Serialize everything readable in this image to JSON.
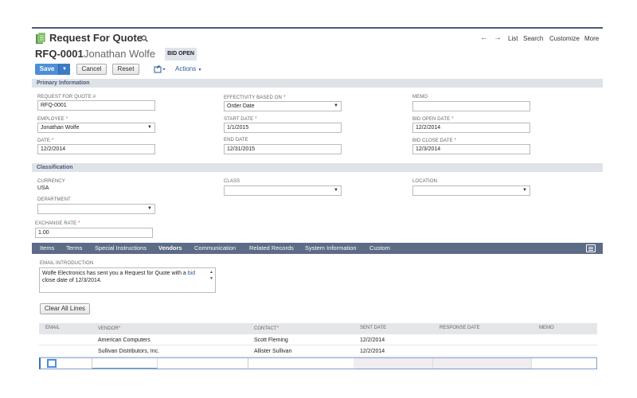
{
  "header": {
    "page_title": "Request For Quote",
    "record_number": "RFQ-0001",
    "record_name": "Jonathan Wolfe",
    "status": "BID OPEN",
    "nav_links": [
      "List",
      "Search",
      "Customize",
      "More"
    ]
  },
  "toolbar": {
    "save_label": "Save",
    "cancel_label": "Cancel",
    "reset_label": "Reset",
    "actions_label": "Actions"
  },
  "primary": {
    "section_title": "Primary Information",
    "rfq_number_label": "REQUEST FOR QUOTE #",
    "rfq_number_value": "RFQ-0001",
    "employee_label": "EMPLOYEE",
    "employee_value": "Jonathan Wolfe",
    "date_label": "DATE",
    "date_value": "12/2/2014",
    "effectivity_label": "EFFECTIVITY BASED ON",
    "effectivity_value": "Order Date",
    "start_date_label": "START DATE",
    "start_date_value": "1/1/2015",
    "end_date_label": "END DATE",
    "end_date_value": "12/31/2015",
    "memo_label": "MEMO",
    "memo_value": "",
    "bid_open_label": "BID OPEN DATE",
    "bid_open_value": "12/2/2014",
    "bid_close_label": "BID CLOSE DATE",
    "bid_close_value": "12/3/2014"
  },
  "classification": {
    "section_title": "Classification",
    "currency_label": "CURRENCY",
    "currency_value": "USA",
    "department_label": "DEPARTMENT",
    "department_value": "",
    "class_label": "CLASS",
    "class_value": "",
    "location_label": "LOCATION",
    "location_value": "",
    "exchange_rate_label": "EXCHANGE RATE",
    "exchange_rate_value": "1.00"
  },
  "tabs": [
    "Items",
    "Terms",
    "Special Instructions",
    "Vendors",
    "Communication",
    "Related Records",
    "System Information",
    "Custom"
  ],
  "vendors_tab": {
    "email_intro_label": "EMAIL INTRODUCTION",
    "email_intro_part1": "Wolfe Electronics has sent you a Request for Quote with a ",
    "email_intro_link": "bid",
    "email_intro_part2": " close date of 12/3/2014.",
    "clear_all_label": "Clear All Lines",
    "columns": [
      "EMAIL",
      "VENDOR",
      "CONTACT",
      "SENT DATE",
      "RESPONSE DATE",
      "MEMO"
    ],
    "rows": [
      {
        "vendor": "American Computers",
        "contact": "Scott Fleming",
        "sent_date": "12/2/2014"
      },
      {
        "vendor": "Sullivan Distributors, Inc.",
        "contact": "Allister Sullivan",
        "sent_date": "12/2/2014"
      }
    ]
  },
  "colors": {
    "accent": "#4d8fd6",
    "tabbar": "#5c6b86",
    "section_bg": "#dfe3e8",
    "required": "#e6732f"
  }
}
